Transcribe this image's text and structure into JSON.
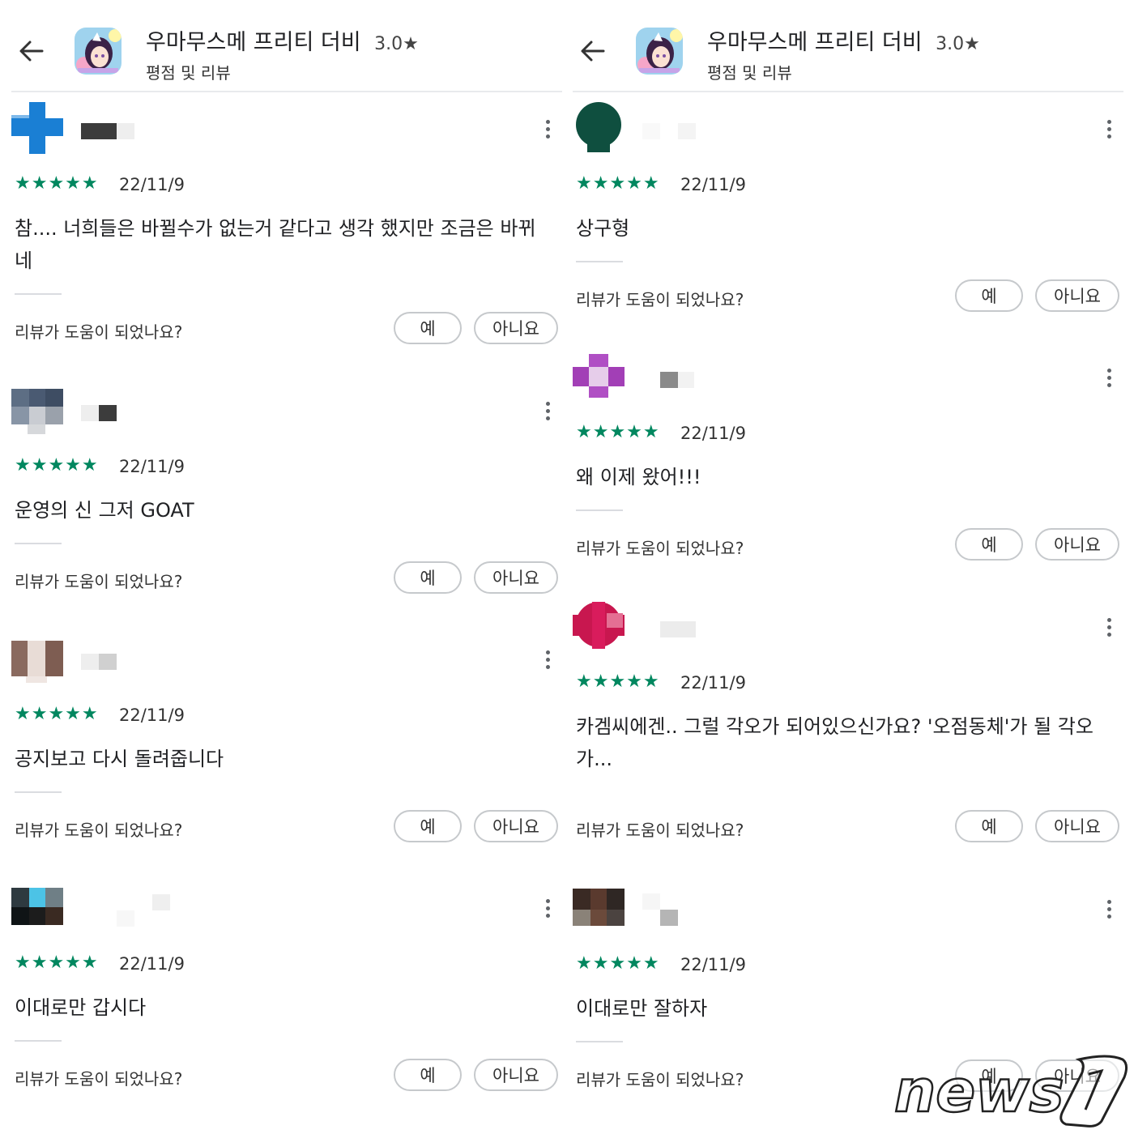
{
  "header": {
    "title": "우마무스메 프리티 더비",
    "rating": "3.0★",
    "subtitle": "평점 및 리뷰"
  },
  "helpful_prompt": "리뷰가 도움이 되었나요?",
  "yes_label": "예",
  "no_label": "아니요",
  "star_glyphs": "★★★★★",
  "colors": {
    "star": "#01875f",
    "text": "#202124",
    "border": "#dadce0"
  },
  "left_reviews": [
    {
      "stars": 5,
      "date": "22/11/9",
      "text": "참.... 너희들은 바뀔수가 없는거 같다고 생각 했지만 조금은 바뀌네",
      "avatar": "blue cross"
    },
    {
      "stars": 5,
      "date": "22/11/9",
      "text": "운영의 신 그저 GOAT",
      "avatar": "blurred slate"
    },
    {
      "stars": 5,
      "date": "22/11/9",
      "text": "공지보고 다시 돌려줍니다",
      "avatar": "blurred brown"
    },
    {
      "stars": 5,
      "date": "22/11/9",
      "text": "이대로만 갑시다",
      "avatar": "blurred dark"
    }
  ],
  "right_reviews": [
    {
      "stars": 5,
      "date": "22/11/9",
      "text": "상구형",
      "avatar": "dark green"
    },
    {
      "stars": 5,
      "date": "22/11/9",
      "text": "왜 이제 왔어!!!",
      "avatar": "blurred purple"
    },
    {
      "stars": 5,
      "date": "22/11/9",
      "text": "카겜씨에겐.. 그럴 각오가 되어있으신가요? '오점동체'가 될 각오가...",
      "avatar": "blurred crimson"
    },
    {
      "stars": 5,
      "date": "22/11/9",
      "text": "이대로만 잘하자",
      "avatar": "blurred brown"
    }
  ],
  "watermark": "news1"
}
